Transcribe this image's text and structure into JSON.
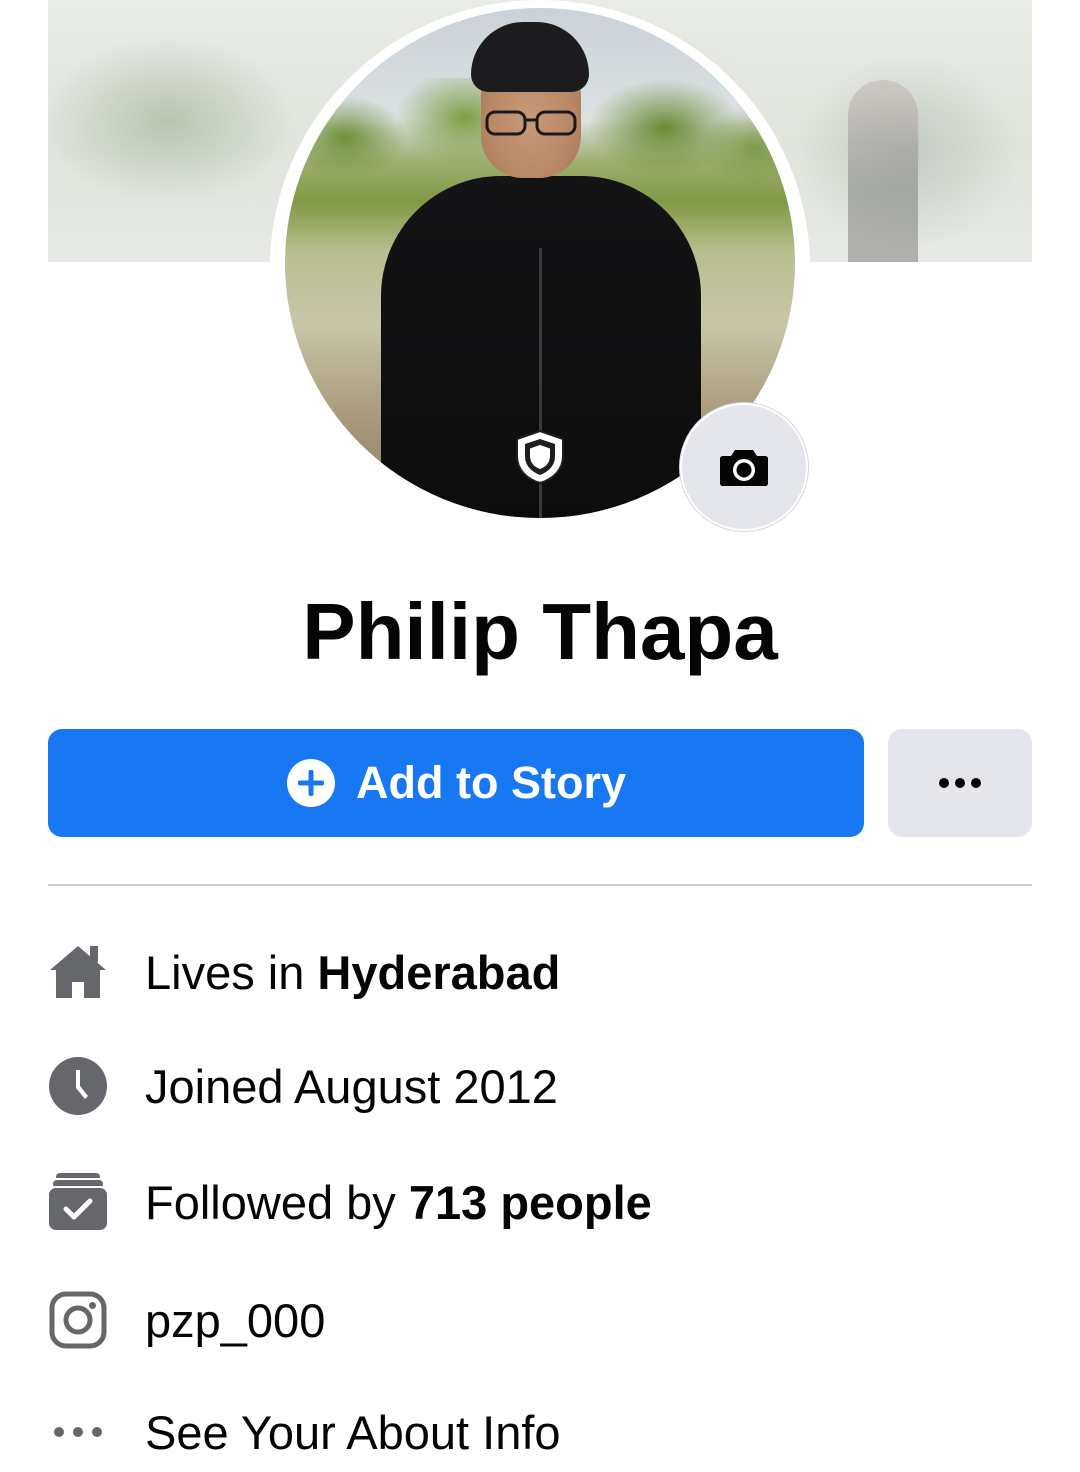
{
  "profile": {
    "name": "Philip Thapa"
  },
  "actions": {
    "add_story_label": "Add to Story",
    "more_icon": "more-horizontal-icon"
  },
  "details": {
    "lives_prefix": "Lives in ",
    "lives_value": "Hyderabad",
    "joined": "Joined August 2012",
    "followed_prefix": "Followed by ",
    "followed_value": "713 people",
    "instagram_handle": "pzp_000",
    "see_about": "See Your About Info"
  },
  "icons": {
    "home": "home-icon",
    "clock": "clock-icon",
    "followers": "followers-icon",
    "instagram": "instagram-icon",
    "more": "more-dots-icon",
    "camera": "camera-icon",
    "shield": "profile-guard-shield-icon",
    "plus": "plus-circle-icon"
  },
  "colors": {
    "primary": "#1877f2",
    "secondary_button": "#e4e6eb",
    "icon_gray": "#65676b",
    "divider": "#ced0d4",
    "text": "#050505"
  }
}
